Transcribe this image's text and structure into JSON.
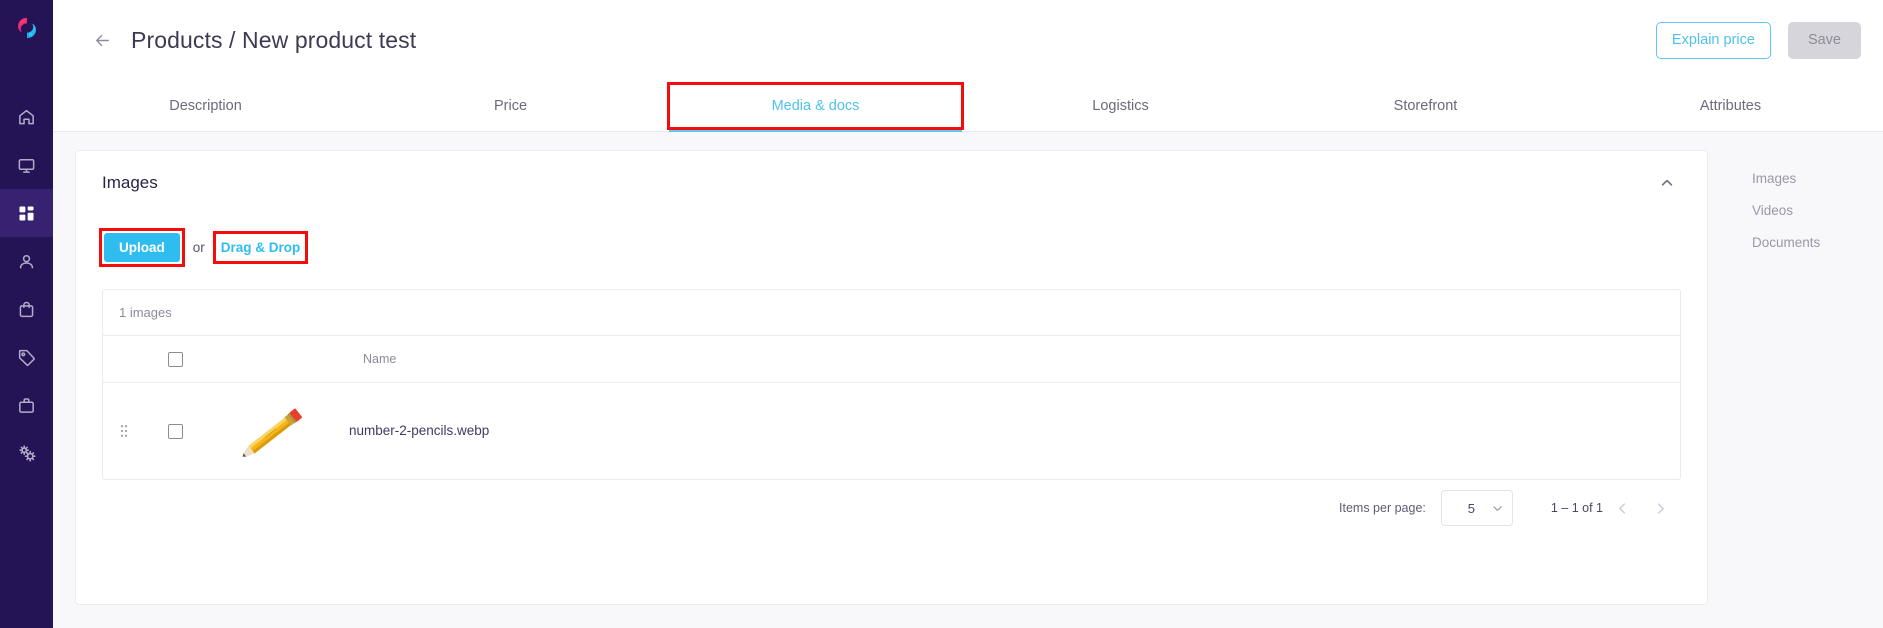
{
  "app": {
    "logo_name": "brand-logo",
    "accent_blue": "#2fbdf0",
    "sidebar_bg": "#241456",
    "annotation_color": "#f40b0b"
  },
  "sidebar": {
    "items": [
      {
        "icon": "home-icon",
        "name": "sidebar-item-home",
        "active": false
      },
      {
        "icon": "monitor-icon",
        "name": "sidebar-item-dashboard",
        "active": false
      },
      {
        "icon": "grid-icon",
        "name": "sidebar-item-products",
        "active": true
      },
      {
        "icon": "user-icon",
        "name": "sidebar-item-customers",
        "active": false
      },
      {
        "icon": "shopping-bag-icon",
        "name": "sidebar-item-orders",
        "active": false
      },
      {
        "icon": "tag-icon",
        "name": "sidebar-item-pricing",
        "active": false
      },
      {
        "icon": "briefcase-icon",
        "name": "sidebar-item-business",
        "active": false
      },
      {
        "icon": "settings-gears-icon",
        "name": "sidebar-item-settings",
        "active": false
      }
    ]
  },
  "header": {
    "back_icon": "back-arrow-icon",
    "title": "Products / New product test",
    "explain_price_label": "Explain price",
    "save_label": "Save"
  },
  "tabs": [
    {
      "label": "Description",
      "active": false,
      "annotated": false
    },
    {
      "label": "Price",
      "active": false,
      "annotated": false
    },
    {
      "label": "Media & docs",
      "active": true,
      "annotated": true
    },
    {
      "label": "Logistics",
      "active": false,
      "annotated": false
    },
    {
      "label": "Storefront",
      "active": false,
      "annotated": false
    },
    {
      "label": "Attributes",
      "active": false,
      "annotated": false
    }
  ],
  "images_card": {
    "title": "Images",
    "collapse_icon": "chevron-up-icon",
    "upload_label": "Upload",
    "or_label": "or",
    "drag_drop_label": "Drag & Drop",
    "count_label": "1 images",
    "columns": {
      "name": "Name"
    },
    "rows": [
      {
        "drag_handle": "drag-handle-icon",
        "thumbnail": "pencil-thumbnail",
        "name": "number-2-pencils.webp",
        "checked": false
      }
    ]
  },
  "pagination": {
    "items_per_page_label": "Items per page:",
    "items_per_page_value": "5",
    "dropdown_icon": "chevron-down-icon",
    "range_label": "1 – 1 of 1",
    "prev_icon": "chevron-left-icon",
    "next_icon": "chevron-right-icon"
  },
  "right_nav": {
    "items": [
      {
        "label": "Images"
      },
      {
        "label": "Videos"
      },
      {
        "label": "Documents"
      }
    ]
  }
}
